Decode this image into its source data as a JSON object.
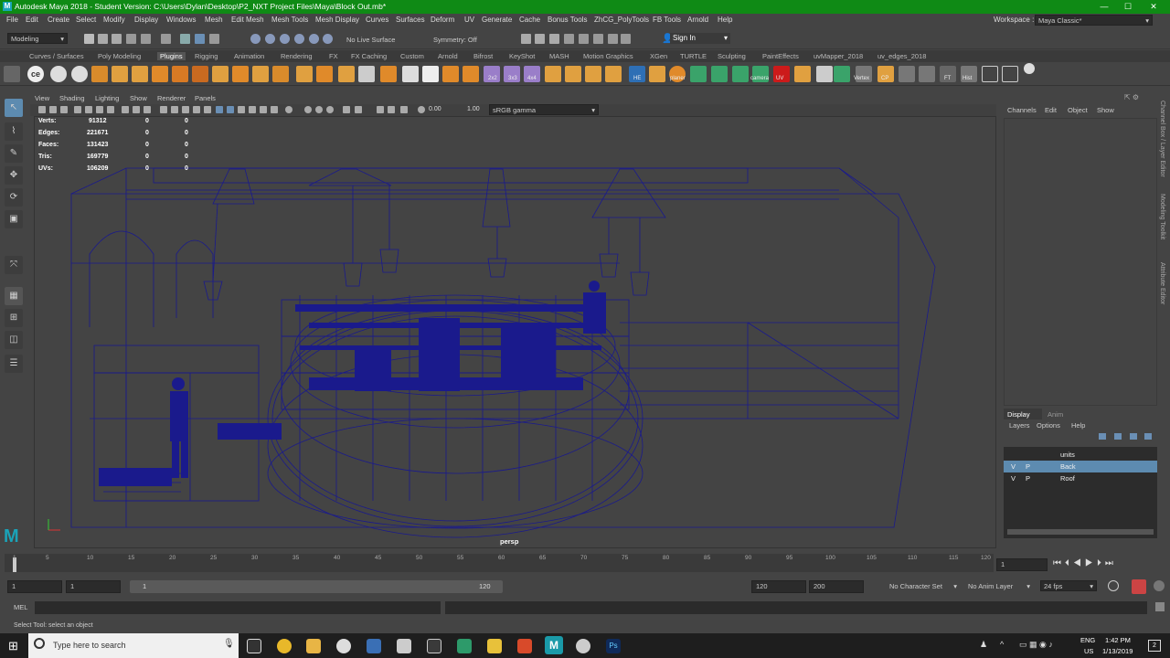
{
  "window": {
    "title": "Autodesk Maya 2018 - Student Version: C:\\Users\\Dylan\\Desktop\\P2_NXT Project Files\\Maya\\Block Out.mb*",
    "workspace_label": "Workspace :",
    "workspace_value": "Maya Classic*"
  },
  "menu": [
    "File",
    "Edit",
    "Create",
    "Select",
    "Modify",
    "Display",
    "Windows",
    "Mesh",
    "Edit Mesh",
    "Mesh Tools",
    "Mesh Display",
    "Curves",
    "Surfaces",
    "Deform",
    "UV",
    "Generate",
    "Cache",
    "Bonus Tools",
    "ZhCG_PolyTools",
    "FB Tools",
    "Arnold",
    "Help"
  ],
  "status": {
    "mode": "Modeling",
    "live": "No Live Surface",
    "symmetry": "Symmetry: Off",
    "signin": "Sign In"
  },
  "shelf_tabs": [
    "Curves / Surfaces",
    "Poly Modeling",
    "Plugins",
    "Rigging",
    "Animation",
    "Rendering",
    "FX",
    "FX Caching",
    "Custom",
    "Arnold",
    "Bifrost",
    "KeyShot",
    "MASH",
    "Motion Graphics",
    "XGen",
    "TURTLE",
    "Sculpting",
    "PaintEffects",
    "uvMapper_2018",
    "uv_edges_2018"
  ],
  "shelf_active": "Plugins",
  "shelf_labels": [
    "2x2",
    "3x3",
    "4x4",
    "HE",
    "planer",
    "camera",
    "UV",
    "Vertex",
    "CP",
    "FT",
    "Hist"
  ],
  "panel_menu": [
    "View",
    "Shading",
    "Lighting",
    "Show",
    "Renderer",
    "Panels"
  ],
  "panel_tools": {
    "exposure": "0.00",
    "gamma": "1.00",
    "colorspace": "sRGB gamma"
  },
  "hud": [
    {
      "label": "Verts:",
      "total": "91312",
      "sel": "0",
      "comp": "0"
    },
    {
      "label": "Edges:",
      "total": "221671",
      "sel": "0",
      "comp": "0"
    },
    {
      "label": "Faces:",
      "total": "131423",
      "sel": "0",
      "comp": "0"
    },
    {
      "label": "Tris:",
      "total": "169779",
      "sel": "0",
      "comp": "0"
    },
    {
      "label": "UVs:",
      "total": "106209",
      "sel": "0",
      "comp": "0"
    }
  ],
  "camera": "persp",
  "channel_menu": [
    "Channels",
    "Edit",
    "Object",
    "Show"
  ],
  "vertical_tabs": [
    "Channel Box / Layer Editor",
    "Modeling Toolkit",
    "Attribute Editor"
  ],
  "layer_tabs": [
    "Display",
    "Anim"
  ],
  "layer_menu": [
    "Layers",
    "Options",
    "Help"
  ],
  "layers": [
    {
      "v": "",
      "p": "",
      "name": "units",
      "selected": false
    },
    {
      "v": "V",
      "p": "P",
      "name": "Back",
      "selected": true
    },
    {
      "v": "V",
      "p": "P",
      "name": "Roof",
      "selected": false
    }
  ],
  "timeline": {
    "ticks": [
      "1",
      "5",
      "10",
      "15",
      "20",
      "25",
      "30",
      "35",
      "40",
      "45",
      "50",
      "55",
      "60",
      "65",
      "70",
      "75",
      "80",
      "85",
      "90",
      "95",
      "100",
      "105",
      "110",
      "115",
      "120"
    ],
    "current": "1"
  },
  "range": {
    "start": "1",
    "playstart": "1",
    "slider_start": "1",
    "slider_end": "120",
    "playend": "120",
    "end": "200",
    "character": "No Character Set",
    "animlayer": "No Anim Layer",
    "fps": "24 fps"
  },
  "mel": {
    "label": "MEL"
  },
  "helpline": "Select Tool: select an object",
  "taskbar": {
    "search": "Type here to search",
    "lang": "ENG",
    "region": "US",
    "time": "1:42 PM",
    "date": "1/13/2019",
    "badge": "2"
  },
  "colors": {
    "titlebar": "#0f8a15",
    "wire": "#1a1a8c",
    "selected_layer": "#5d8bb0"
  }
}
